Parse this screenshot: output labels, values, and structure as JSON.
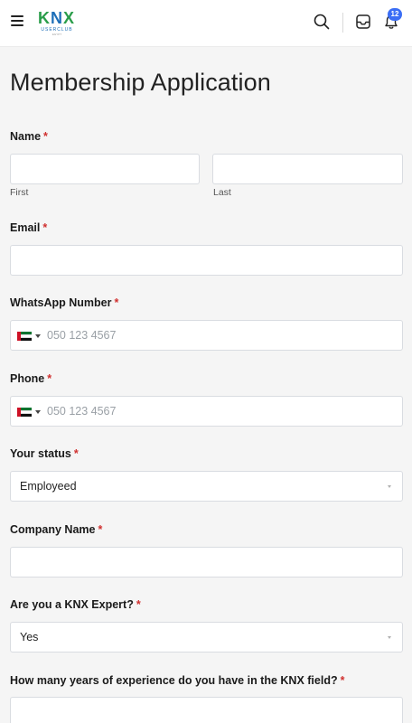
{
  "header": {
    "logo": {
      "mark_k": "K",
      "mark_n": "N",
      "mark_x": "X",
      "sub": "USERCLUB",
      "sub2": "EGYPT"
    },
    "notifications_count": "12",
    "icons": [
      "menu-icon",
      "search-icon",
      "inbox-icon",
      "bell-icon"
    ]
  },
  "form": {
    "title": "Membership Application",
    "required_mark": "*",
    "name": {
      "label": "Name",
      "first_sublabel": "First",
      "last_sublabel": "Last",
      "first_value": "",
      "last_value": ""
    },
    "email": {
      "label": "Email",
      "value": ""
    },
    "whatsapp": {
      "label": "WhatsApp Number",
      "placeholder": "050 123 4567",
      "country": "AE"
    },
    "phone": {
      "label": "Phone",
      "placeholder": "050 123 4567",
      "country": "AE"
    },
    "status": {
      "label": "Your status",
      "selected": "Employeed"
    },
    "company": {
      "label": "Company Name",
      "value": ""
    },
    "knx_expert": {
      "label": "Are you a KNX Expert?",
      "selected": "Yes"
    },
    "experience": {
      "label": "How many years of experience do you have in the KNX field?",
      "value": ""
    }
  },
  "colors": {
    "accent": "#3b6ef5",
    "required": "#d0302f",
    "logo_green": "#2a9d4a",
    "logo_blue": "#1e6fb8"
  }
}
